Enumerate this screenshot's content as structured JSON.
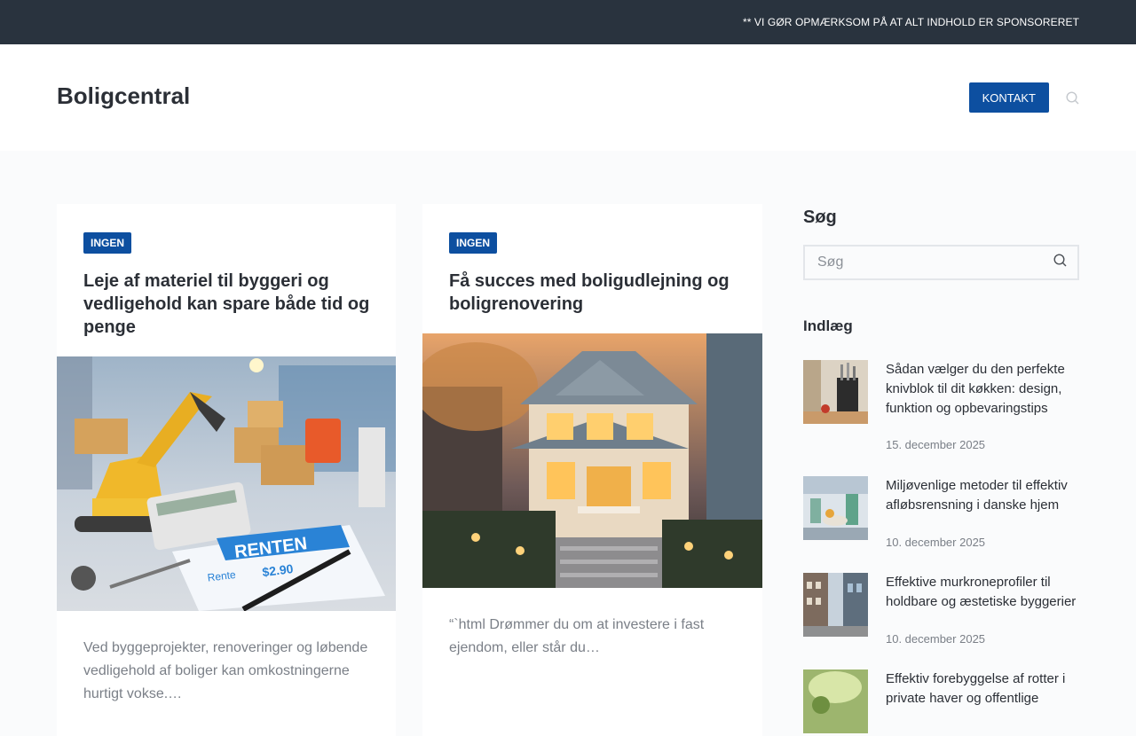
{
  "topbar": {
    "notice": "** VI GØR OPMÆRKSOM PÅ AT ALT INDHOLD ER SPONSORERET"
  },
  "header": {
    "logo": "Boligcentral",
    "contact_label": "KONTAKT"
  },
  "posts": [
    {
      "category": "INGEN",
      "title": "Leje af materiel til byggeri og vedligehold kan spare både tid og penge",
      "excerpt": "Ved byggeprojekter, renoveringer og løbende vedligehold af boliger kan omkostningerne hurtigt vokse.…",
      "image_text": {
        "label": "RENTEN",
        "rente": "Rente",
        "price": "$2.90"
      }
    },
    {
      "category": "INGEN",
      "title": "Få succes med boligudlejning og boligrenovering",
      "excerpt": "“`html Drømmer du om at investere i fast ejendom, eller står du…"
    }
  ],
  "sidebar": {
    "search_heading": "Søg",
    "search_placeholder": "Søg",
    "posts_heading": "Indlæg",
    "posts": [
      {
        "title": "Sådan vælger du den perfekte knivblok til dit køkken: design, funktion og opbevaringstips",
        "date": "15. december 2025"
      },
      {
        "title": "Miljøvenlige metoder til effektiv afløbsrensning i danske hjem",
        "date": "10. december 2025"
      },
      {
        "title": "Effektive murkroneprofiler til holdbare og æstetiske byggerier",
        "date": "10. december 2025"
      },
      {
        "title": "Effektiv forebyggelse af rotter i private haver og offentlige",
        "date": ""
      }
    ]
  },
  "colors": {
    "topbar": "#29333e",
    "accent": "#0d4fa0",
    "text": "#2b2f36",
    "muted": "#7a7f87"
  }
}
